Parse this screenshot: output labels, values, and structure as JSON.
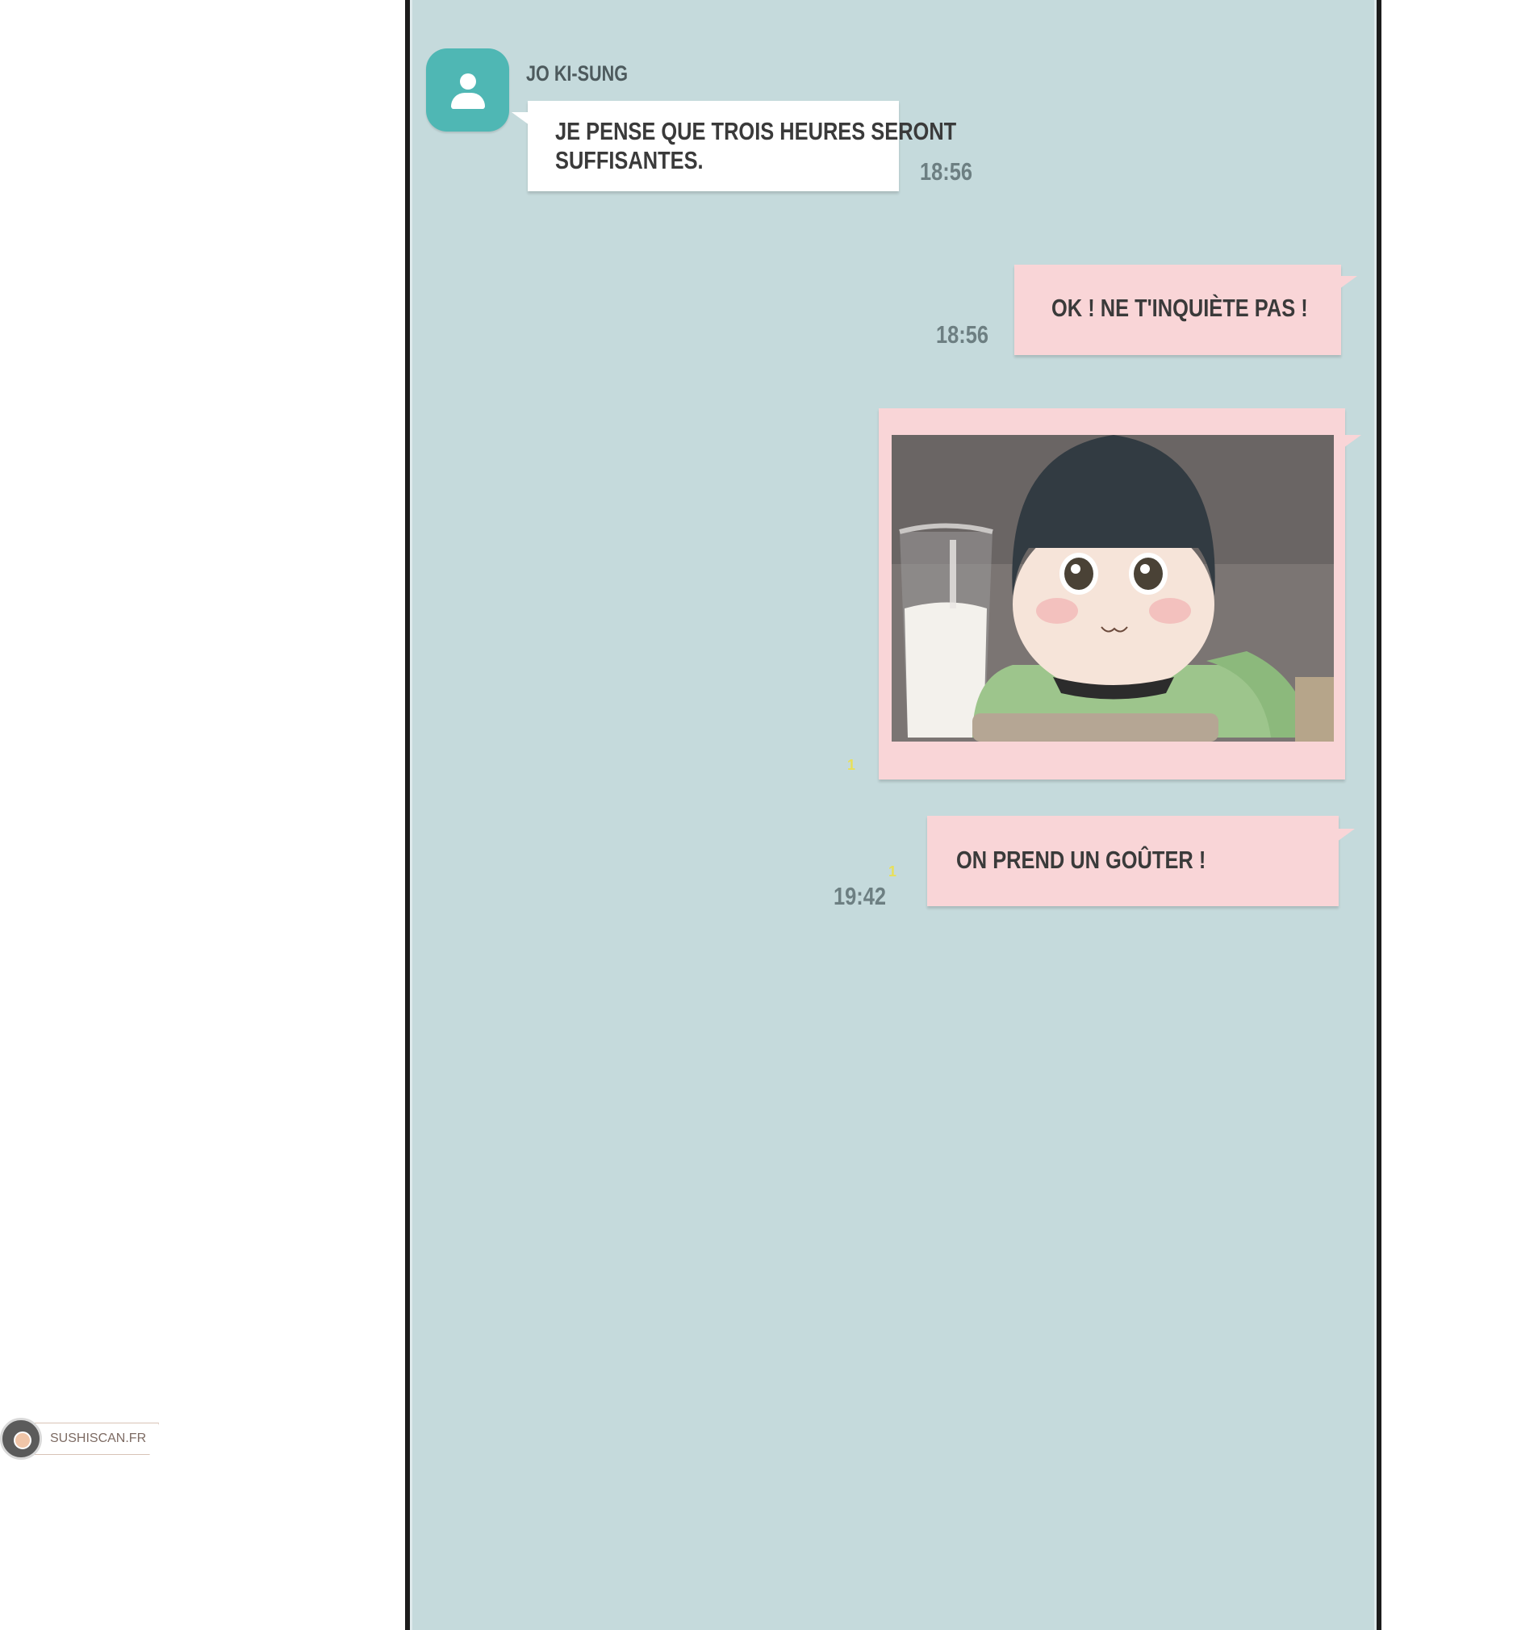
{
  "chat": {
    "contact_name": "JO KI-SUNG",
    "messages": [
      {
        "sender": "JO KI-SUNG",
        "direction": "incoming",
        "type": "text",
        "lines": [
          "JE PENSE QUE TROIS HEURES SERONT",
          "SUFFISANTES."
        ],
        "time": "18:56"
      },
      {
        "direction": "outgoing",
        "type": "text",
        "lines": [
          "OK ! NE T'INQUIÈTE PAS !"
        ],
        "time": "18:56"
      },
      {
        "direction": "outgoing",
        "type": "image",
        "image_icon": "child-with-milk-glass-illustration",
        "read_marker": "1"
      },
      {
        "direction": "outgoing",
        "type": "text",
        "lines": [
          "ON PREND UN GOÛTER !"
        ],
        "time": "19:42",
        "read_marker": "1"
      }
    ]
  },
  "colors": {
    "chat_background": "#c5dadc",
    "incoming_bubble": "#ffffff",
    "outgoing_bubble": "#f9d5d7",
    "avatar": "#4fb7b4",
    "timestamp": "#6d7f82",
    "read_marker": "#e8e05a"
  },
  "watermark": {
    "text": "SUSHISCAN.FR"
  }
}
